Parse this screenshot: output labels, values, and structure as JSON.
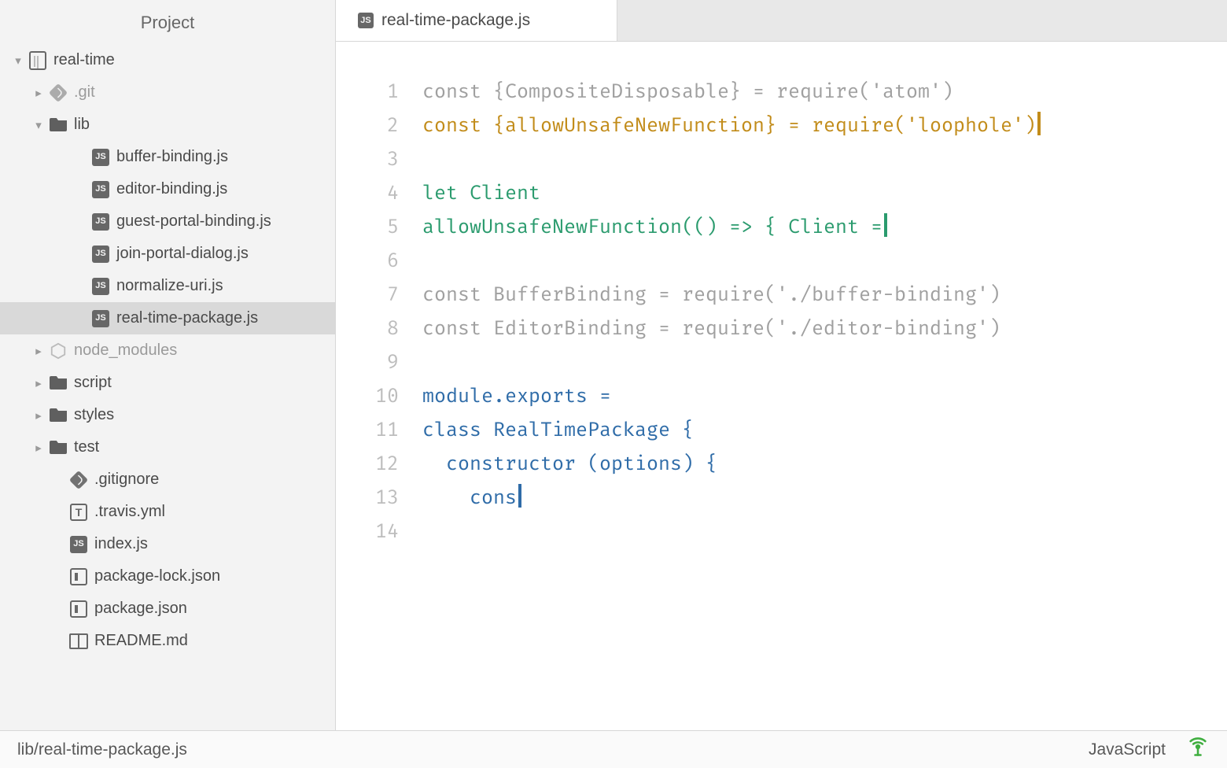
{
  "sidebar": {
    "title": "Project",
    "root": {
      "label": "real-time",
      "expanded": true
    },
    "tree": [
      {
        "id": "git",
        "label": ".git",
        "kind": "git-folder",
        "level": 1,
        "muted": true,
        "chev": "right"
      },
      {
        "id": "lib",
        "label": "lib",
        "kind": "folder",
        "level": 1,
        "chev": "down"
      },
      {
        "id": "bufbind",
        "label": "buffer-binding.js",
        "kind": "js",
        "level": 3
      },
      {
        "id": "edbind",
        "label": "editor-binding.js",
        "kind": "js",
        "level": 3
      },
      {
        "id": "guest",
        "label": "guest-portal-binding.js",
        "kind": "js",
        "level": 3
      },
      {
        "id": "join",
        "label": "join-portal-dialog.js",
        "kind": "js",
        "level": 3
      },
      {
        "id": "norm",
        "label": "normalize-uri.js",
        "kind": "js",
        "level": 3
      },
      {
        "id": "rtpkg",
        "label": "real-time-package.js",
        "kind": "js",
        "level": 3,
        "selected": true
      },
      {
        "id": "nodemod",
        "label": "node_modules",
        "kind": "hex",
        "level": 1,
        "muted": true,
        "chev": "right"
      },
      {
        "id": "script",
        "label": "script",
        "kind": "folder",
        "level": 1,
        "chev": "right"
      },
      {
        "id": "styles",
        "label": "styles",
        "kind": "folder",
        "level": 1,
        "chev": "right"
      },
      {
        "id": "test",
        "label": "test",
        "kind": "folder",
        "level": 1,
        "chev": "right"
      },
      {
        "id": "gitign",
        "label": ".gitignore",
        "kind": "git-file",
        "level": 2
      },
      {
        "id": "travis",
        "label": ".travis.yml",
        "kind": "yml",
        "level": 2
      },
      {
        "id": "index",
        "label": "index.js",
        "kind": "js",
        "level": 2
      },
      {
        "id": "pkglock",
        "label": "package-lock.json",
        "kind": "json",
        "level": 2
      },
      {
        "id": "pkg",
        "label": "package.json",
        "kind": "json",
        "level": 2
      },
      {
        "id": "readme",
        "label": "README.md",
        "kind": "book",
        "level": 2
      }
    ]
  },
  "tab": {
    "label": "real-time-package.js"
  },
  "editor": {
    "lines": [
      {
        "n": 1,
        "segs": [
          [
            "",
            "const {CompositeDisposable} = require('atom')"
          ]
        ]
      },
      {
        "n": 2,
        "segs": [
          [
            "key",
            "const {allowUnsafeNewFunction} = require('loophole')"
          ]
        ],
        "cursor": "amber"
      },
      {
        "n": 3,
        "segs": [
          [
            "",
            ""
          ]
        ]
      },
      {
        "n": 4,
        "segs": [
          [
            "grn",
            "let Client"
          ]
        ]
      },
      {
        "n": 5,
        "segs": [
          [
            "grn",
            "allowUnsafeNewFunction(() => { Client ="
          ]
        ],
        "cursor": "green"
      },
      {
        "n": 6,
        "segs": [
          [
            "",
            ""
          ]
        ]
      },
      {
        "n": 7,
        "segs": [
          [
            "",
            "const BufferBinding = require('./buffer-binding')"
          ]
        ]
      },
      {
        "n": 8,
        "segs": [
          [
            "",
            "const EditorBinding = require('./editor-binding')"
          ]
        ]
      },
      {
        "n": 9,
        "segs": [
          [
            "",
            ""
          ]
        ]
      },
      {
        "n": 10,
        "segs": [
          [
            "blu",
            "module.exports ="
          ]
        ]
      },
      {
        "n": 11,
        "segs": [
          [
            "blu",
            "class RealTimePackage {"
          ]
        ]
      },
      {
        "n": 12,
        "segs": [
          [
            "blu",
            "  constructor (options) {"
          ]
        ]
      },
      {
        "n": 13,
        "segs": [
          [
            "blu",
            "    cons"
          ]
        ],
        "cursor": "blue"
      },
      {
        "n": 14,
        "segs": [
          [
            "",
            ""
          ]
        ]
      }
    ]
  },
  "status": {
    "path": "lib/real-time-package.js",
    "language": "JavaScript"
  }
}
